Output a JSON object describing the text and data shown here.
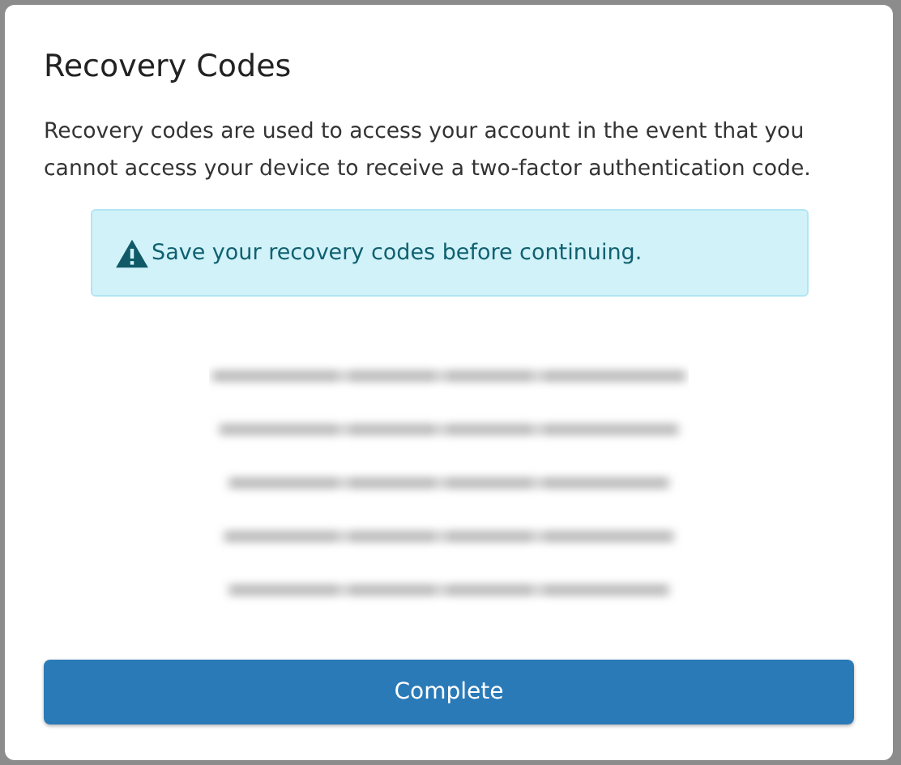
{
  "dialog": {
    "title": "Recovery Codes",
    "description": "Recovery codes are used to access your account in the event that you cannot access your device to receive a two-factor authentication code.",
    "alert": {
      "text": "Save your recovery codes before continuing."
    },
    "codes": [
      {
        "kind": "blurred"
      },
      {
        "kind": "blurred"
      },
      {
        "kind": "blurred"
      },
      {
        "kind": "blurred"
      },
      {
        "kind": "blurred"
      }
    ],
    "buttons": [
      "Complete"
    ]
  }
}
